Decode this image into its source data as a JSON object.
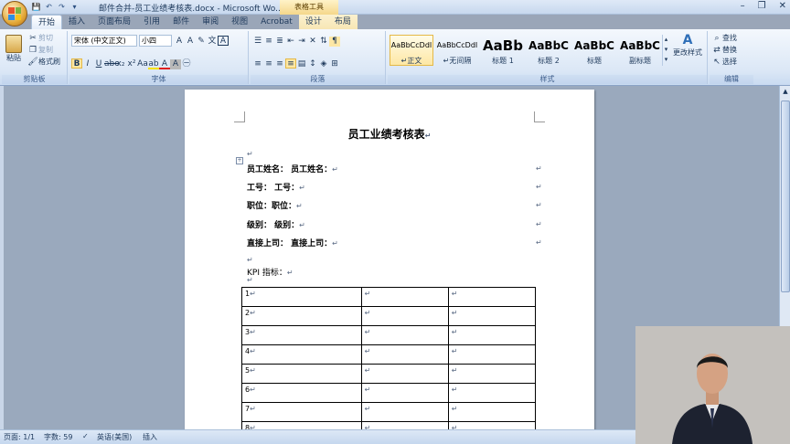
{
  "window": {
    "title": "邮件合并-员工业绩考核表.docx - Microsoft Wo...",
    "contextual_tools": "表格工具",
    "controls": [
      "–",
      "❐",
      "✕"
    ]
  },
  "tabs": [
    {
      "label": "开始",
      "active": true
    },
    {
      "label": "插入"
    },
    {
      "label": "页面布局"
    },
    {
      "label": "引用"
    },
    {
      "label": "邮件"
    },
    {
      "label": "审阅"
    },
    {
      "label": "视图"
    },
    {
      "label": "Acrobat"
    },
    {
      "label": "设计",
      "contextual": true
    },
    {
      "label": "布局",
      "contextual": true
    }
  ],
  "ribbon": {
    "clipboard": {
      "label": "剪贴板",
      "paste": "粘贴",
      "cut": "剪切",
      "copy": "复制",
      "format_painter": "格式刷"
    },
    "font": {
      "label": "字体",
      "font_name": "宋体 (中文正文)",
      "font_size": "小四"
    },
    "paragraph": {
      "label": "段落"
    },
    "styles": {
      "label": "样式",
      "items": [
        {
          "sample": "AaBbCcDdI",
          "name": "↵正文",
          "selected": true
        },
        {
          "sample": "AaBbCcDdI",
          "name": "↵无间隔"
        },
        {
          "sample": "AaBb",
          "name": "标题 1"
        },
        {
          "sample": "AaBbC",
          "name": "标题 2"
        },
        {
          "sample": "AaBbC",
          "name": "标题"
        },
        {
          "sample": "AaBbC",
          "name": "副标题"
        }
      ],
      "change_styles": "更改样式"
    },
    "editing": {
      "label": "编辑",
      "find": "查找",
      "replace": "替换",
      "select": "选择"
    }
  },
  "document": {
    "heading": "员工业绩考核表",
    "fields": [
      "员工姓名：  员工姓名：",
      "工号：  工号：",
      "职位：职位：",
      "级别：  级别：",
      "直接上司：  直接上司："
    ],
    "kpi_label": "KPI 指标：",
    "kpi_rows": [
      "1",
      "2",
      "3",
      "4",
      "5",
      "6",
      "7",
      "8"
    ]
  },
  "status": {
    "page": "页面: 1/1",
    "words": "字数: 59",
    "language": "英语(美国)",
    "mode": "插入"
  }
}
